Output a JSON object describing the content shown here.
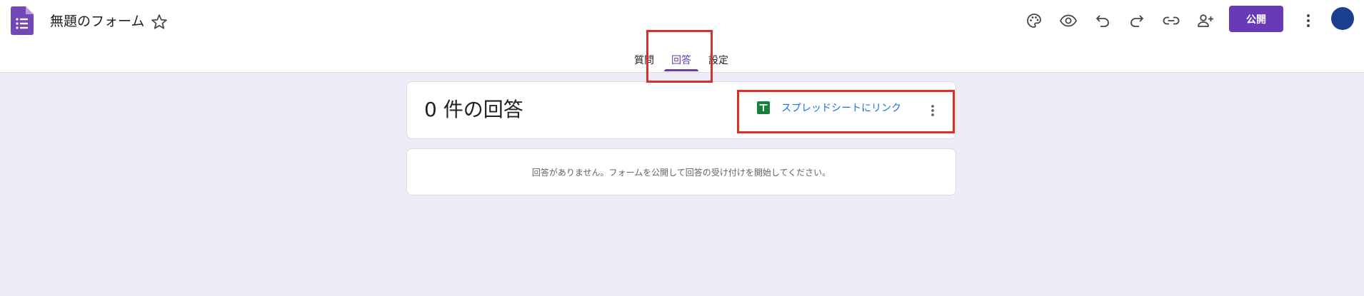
{
  "header": {
    "title": "無題のフォーム",
    "publish_label": "公開",
    "toolbar_icons": [
      "palette-icon",
      "eye-icon",
      "undo-icon",
      "redo-icon",
      "link-icon",
      "add-person-icon",
      "more-vert-icon"
    ]
  },
  "tabs": [
    {
      "label": "質問",
      "active": false
    },
    {
      "label": "回答",
      "active": true
    },
    {
      "label": "設定",
      "active": false
    }
  ],
  "responses": {
    "count_label": "0 件の回答",
    "sheets_link_label": "スプレッドシートにリンク",
    "empty_message": "回答がありません。フォームを公開して回答の受け付けを開始してください。"
  },
  "colors": {
    "accent": "#673ab7",
    "background": "#f0ebf8",
    "link": "#1a73e8",
    "sheets_green": "#188038",
    "highlight": "#d93025",
    "avatar": "#1a3f8f"
  }
}
